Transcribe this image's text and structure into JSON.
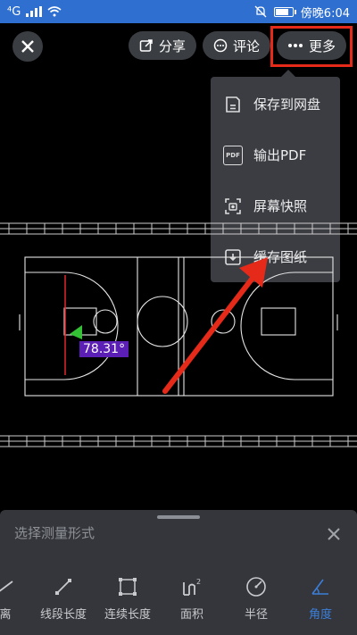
{
  "statusbar": {
    "carrier": "⁴G",
    "time_label": "傍晚6:04",
    "battery_level": 0.85
  },
  "toolbar": {
    "share_label": "分享",
    "comment_label": "评论",
    "more_label": "更多"
  },
  "menu": {
    "items": [
      {
        "label": "保存到网盘",
        "icon": "save-icon"
      },
      {
        "label": "输出PDF",
        "icon": "pdf-icon",
        "icon_text": "PDF"
      },
      {
        "label": "屏幕快照",
        "icon": "screenshot-icon"
      },
      {
        "label": "缓存图纸",
        "icon": "download-icon"
      }
    ]
  },
  "drawing": {
    "angle_value": "78.31°"
  },
  "panel": {
    "title": "选择测量形式",
    "tools": [
      {
        "label": "离",
        "icon": "distance-icon"
      },
      {
        "label": "线段长度",
        "icon": "segment-length-icon"
      },
      {
        "label": "连续长度",
        "icon": "continuous-length-icon"
      },
      {
        "label": "面积",
        "icon": "area-icon"
      },
      {
        "label": "半径",
        "icon": "radius-icon"
      },
      {
        "label": "角度",
        "icon": "angle-icon",
        "active": true
      }
    ]
  },
  "colors": {
    "statusbar": "#2e6fd0",
    "highlight": "#e62a1a",
    "accent": "#3c7ed8",
    "angle_tag": "#5b1fb5"
  }
}
